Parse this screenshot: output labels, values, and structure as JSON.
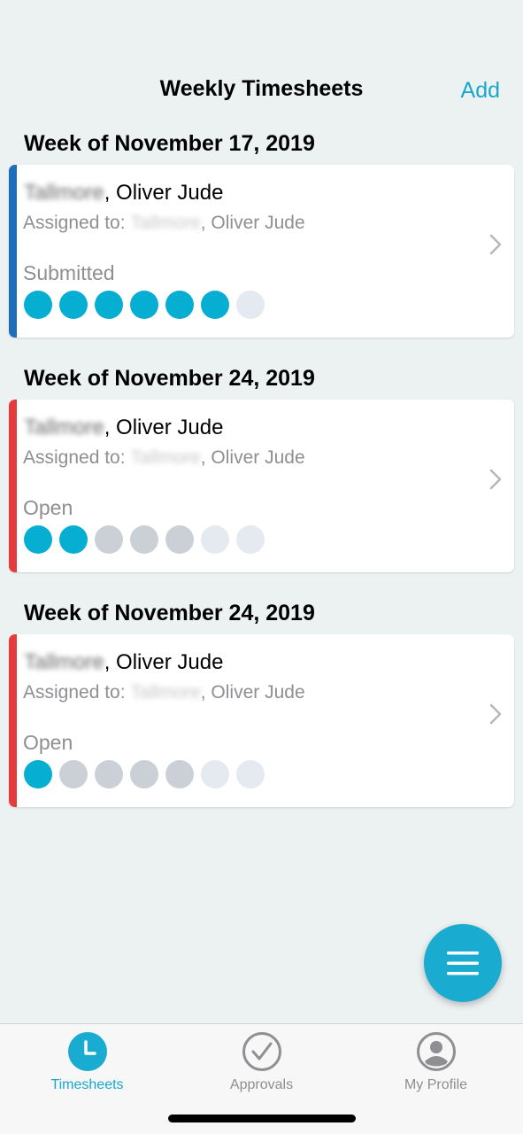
{
  "nav": {
    "title": "Weekly Timesheets",
    "add_label": "Add"
  },
  "colors": {
    "accent": "#19a8cc",
    "submitted": "#1e6fba",
    "open": "#e23c3c",
    "dot_filled": "#06aed2",
    "dot_gray": "#cbd0d6",
    "dot_light": "#e5e9f0"
  },
  "timesheets": [
    {
      "week": "Week of November 17, 2019",
      "last_name": "Tallmore",
      "name_suffix": ", Oliver Jude",
      "assigned_prefix": "Assigned to: ",
      "assigned_last": "Tallmore",
      "assigned_suffix": ", Oliver Jude",
      "status": "Submitted",
      "status_color": "#1e6fba",
      "days": [
        "filled",
        "filled",
        "filled",
        "filled",
        "filled",
        "filled",
        "light"
      ]
    },
    {
      "week": "Week of November 24, 2019",
      "last_name": "Tallmore",
      "name_suffix": ", Oliver Jude",
      "assigned_prefix": "Assigned to: ",
      "assigned_last": "Tallmore",
      "assigned_suffix": ", Oliver Jude",
      "status": "Open",
      "status_color": "#e23c3c",
      "days": [
        "filled",
        "filled",
        "gray",
        "gray",
        "gray",
        "light",
        "light"
      ]
    },
    {
      "week": "Week of November 24, 2019",
      "last_name": "Tallmore",
      "name_suffix": ", Oliver Jude",
      "assigned_prefix": "Assigned to: ",
      "assigned_last": "Tallmore",
      "assigned_suffix": ", Oliver Jude",
      "status": "Open",
      "status_color": "#e23c3c",
      "days": [
        "filled",
        "gray",
        "gray",
        "gray",
        "gray",
        "light",
        "light"
      ]
    }
  ],
  "fab": {
    "icon": "menu-icon"
  },
  "tabs": [
    {
      "label": "Timesheets",
      "icon": "clock-icon",
      "active": true
    },
    {
      "label": "Approvals",
      "icon": "checkmark-circle-icon",
      "active": false
    },
    {
      "label": "My Profile",
      "icon": "person-circle-icon",
      "active": false
    }
  ]
}
